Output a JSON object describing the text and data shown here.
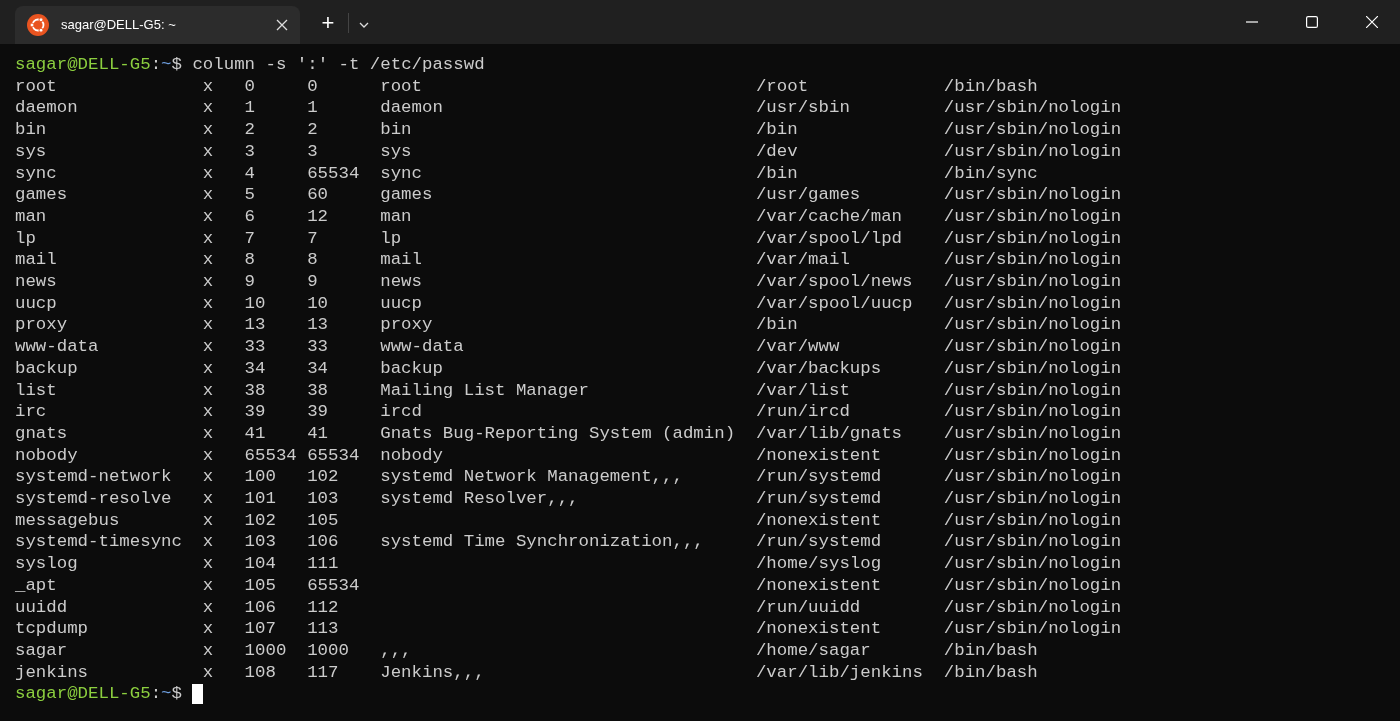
{
  "tab": {
    "title": "sagar@DELL-G5: ~",
    "selected": true
  },
  "new_tab": "+",
  "prompt": {
    "user_host": "sagar@DELL-G5",
    "separator": ":",
    "path": "~",
    "symbol": "$"
  },
  "command": "column -s ':' -t /etc/passwd",
  "rows": [
    [
      "root",
      "x",
      "0",
      "0",
      "root",
      "/root",
      "/bin/bash"
    ],
    [
      "daemon",
      "x",
      "1",
      "1",
      "daemon",
      "/usr/sbin",
      "/usr/sbin/nologin"
    ],
    [
      "bin",
      "x",
      "2",
      "2",
      "bin",
      "/bin",
      "/usr/sbin/nologin"
    ],
    [
      "sys",
      "x",
      "3",
      "3",
      "sys",
      "/dev",
      "/usr/sbin/nologin"
    ],
    [
      "sync",
      "x",
      "4",
      "65534",
      "sync",
      "/bin",
      "/bin/sync"
    ],
    [
      "games",
      "x",
      "5",
      "60",
      "games",
      "/usr/games",
      "/usr/sbin/nologin"
    ],
    [
      "man",
      "x",
      "6",
      "12",
      "man",
      "/var/cache/man",
      "/usr/sbin/nologin"
    ],
    [
      "lp",
      "x",
      "7",
      "7",
      "lp",
      "/var/spool/lpd",
      "/usr/sbin/nologin"
    ],
    [
      "mail",
      "x",
      "8",
      "8",
      "mail",
      "/var/mail",
      "/usr/sbin/nologin"
    ],
    [
      "news",
      "x",
      "9",
      "9",
      "news",
      "/var/spool/news",
      "/usr/sbin/nologin"
    ],
    [
      "uucp",
      "x",
      "10",
      "10",
      "uucp",
      "/var/spool/uucp",
      "/usr/sbin/nologin"
    ],
    [
      "proxy",
      "x",
      "13",
      "13",
      "proxy",
      "/bin",
      "/usr/sbin/nologin"
    ],
    [
      "www-data",
      "x",
      "33",
      "33",
      "www-data",
      "/var/www",
      "/usr/sbin/nologin"
    ],
    [
      "backup",
      "x",
      "34",
      "34",
      "backup",
      "/var/backups",
      "/usr/sbin/nologin"
    ],
    [
      "list",
      "x",
      "38",
      "38",
      "Mailing List Manager",
      "/var/list",
      "/usr/sbin/nologin"
    ],
    [
      "irc",
      "x",
      "39",
      "39",
      "ircd",
      "/run/ircd",
      "/usr/sbin/nologin"
    ],
    [
      "gnats",
      "x",
      "41",
      "41",
      "Gnats Bug-Reporting System (admin)",
      "/var/lib/gnats",
      "/usr/sbin/nologin"
    ],
    [
      "nobody",
      "x",
      "65534",
      "65534",
      "nobody",
      "/nonexistent",
      "/usr/sbin/nologin"
    ],
    [
      "systemd-network",
      "x",
      "100",
      "102",
      "systemd Network Management,,,",
      "/run/systemd",
      "/usr/sbin/nologin"
    ],
    [
      "systemd-resolve",
      "x",
      "101",
      "103",
      "systemd Resolver,,,",
      "/run/systemd",
      "/usr/sbin/nologin"
    ],
    [
      "messagebus",
      "x",
      "102",
      "105",
      "",
      "/nonexistent",
      "/usr/sbin/nologin"
    ],
    [
      "systemd-timesync",
      "x",
      "103",
      "106",
      "systemd Time Synchronization,,,",
      "/run/systemd",
      "/usr/sbin/nologin"
    ],
    [
      "syslog",
      "x",
      "104",
      "111",
      "",
      "/home/syslog",
      "/usr/sbin/nologin"
    ],
    [
      "_apt",
      "x",
      "105",
      "65534",
      "",
      "/nonexistent",
      "/usr/sbin/nologin"
    ],
    [
      "uuidd",
      "x",
      "106",
      "112",
      "",
      "/run/uuidd",
      "/usr/sbin/nologin"
    ],
    [
      "tcpdump",
      "x",
      "107",
      "113",
      "",
      "/nonexistent",
      "/usr/sbin/nologin"
    ],
    [
      "sagar",
      "x",
      "1000",
      "1000",
      ",,,",
      "/home/sagar",
      "/bin/bash"
    ],
    [
      "jenkins",
      "x",
      "108",
      "117",
      "Jenkins,,,",
      "/var/lib/jenkins",
      "/bin/bash"
    ]
  ],
  "final_prompt": {
    "user_host": "sagar@DELL-G5",
    "separator": ":",
    "path": "~",
    "symbol": "$"
  }
}
